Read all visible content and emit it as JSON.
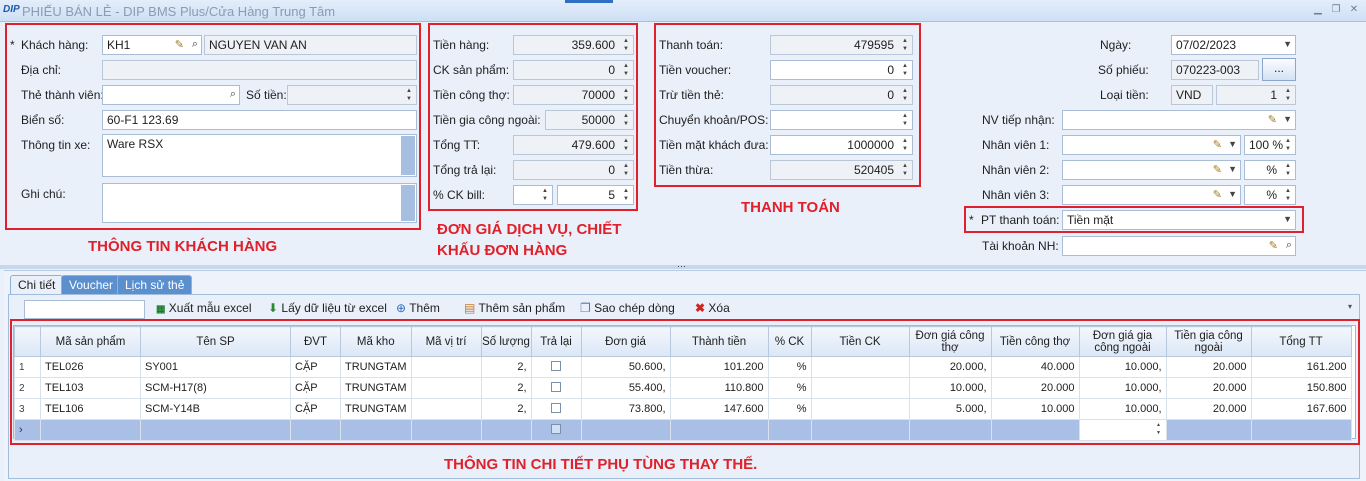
{
  "window": {
    "logo": "DIP",
    "title": "PHIẾU BÁN LẺ - DIP BMS Plus/Cửa Hàng Trung Tâm"
  },
  "customer": {
    "khach_hang_label": "Khách hàng:",
    "khach_hang_code": "KH1",
    "khach_hang_name": "NGUYEN VAN AN",
    "dia_chi_label": "Địa chỉ:",
    "the_thanh_vien_label": "Thẻ thành viên:",
    "so_tien_label": "Số tiền:",
    "bien_so_label": "Biển số:",
    "bien_so": "60-F1 123.69",
    "thong_tin_xe_label": "Thông tin xe:",
    "thong_tin_xe": "Ware RSX",
    "ghi_chu_label": "Ghi chú:",
    "section_label": "THÔNG TIN KHÁCH HÀNG"
  },
  "pricing": {
    "tien_hang_label": "Tiền hàng:",
    "tien_hang": "359.600",
    "ck_san_pham_label": "CK sản phẩm:",
    "ck_san_pham": "0",
    "tien_cong_tho_label": "Tiền công thợ:",
    "tien_cong_tho": "70000",
    "tien_gia_cong_ngoai_label": "Tiền gia công ngoài:",
    "tien_gia_cong_ngoai": "50000",
    "tong_tt_label": "Tổng TT:",
    "tong_tt": "479.600",
    "tong_tra_lai_label": "Tổng trả lại:",
    "tong_tra_lai": "0",
    "ck_bill_label": "% CK bill:",
    "ck_bill": "5",
    "section_label_1": "ĐƠN GIÁ DỊCH VỤ, CHIẾT",
    "section_label_2": "KHẤU ĐƠN HÀNG"
  },
  "payment": {
    "thanh_toan_label": "Thanh toán:",
    "thanh_toan": "479595",
    "tien_voucher_label": "Tiền voucher:",
    "tien_voucher": "0",
    "tru_tien_the_label": "Trừ tiền thẻ:",
    "tru_tien_the": "0",
    "chuyen_khoan_label": "Chuyển khoản/POS:",
    "tien_mat_label": "Tiền mặt khách đưa:",
    "tien_mat": "1000000",
    "tien_thua_label": "Tiền thừa:",
    "tien_thua": "520405",
    "section_label": "THANH TOÁN"
  },
  "info": {
    "ngay_label": "Ngày:",
    "ngay": "07/02/2023",
    "so_phieu_label": "Số phiếu:",
    "so_phieu": "070223-003",
    "browse": "...",
    "loai_tien_label": "Loại tiền:",
    "loai_tien": "VND",
    "ty_gia": "1",
    "nv_tiep_nhan_label": "NV tiếp nhận:",
    "nv1_label": "Nhân viên 1:",
    "nv1_pct": "100 %",
    "nv2_label": "Nhân viên 2:",
    "nv2_pct": "%",
    "nv3_label": "Nhân viên 3:",
    "nv3_pct": "%",
    "pt_thanh_toan_label": "PT thanh toán:",
    "pt_thanh_toan": "Tiền mặt",
    "tai_khoan_label": "Tài khoản NH:"
  },
  "tabs": [
    "Chi tiết",
    "Voucher",
    "Lịch sử thẻ"
  ],
  "toolbar": {
    "xuat_mau": "Xuất mẫu excel",
    "lay_du_lieu": "Lấy dữ liệu từ excel",
    "them": "Thêm",
    "them_san_pham": "Thêm sản phẩm",
    "sao_chep": "Sao chép dòng",
    "xoa": "Xóa"
  },
  "table": {
    "headers": [
      "Mã sản phẩm",
      "Tên SP",
      "ĐVT",
      "Mã kho",
      "Mã vị trí",
      "Số lượng",
      "Trả lại",
      "Đơn giá",
      "Thành tiền",
      "% CK",
      "Tiền CK",
      "Đơn giá công thợ",
      "Tiền công thợ",
      "Đơn giá gia công ngoài",
      "Tiền gia công ngoài",
      "Tổng TT"
    ],
    "rows": [
      {
        "idx": "1",
        "ma": "TEL026",
        "ten": "SY001",
        "dvt": "CẶP",
        "kho": "TRUNGTAM",
        "vitri": "",
        "sl": "2,",
        "don_gia": "50.600,",
        "thanh_tien": "101.200",
        "ck": "%",
        "tien_ck": "",
        "dg_cong": "20.000,",
        "tien_cong": "40.000",
        "dg_gc": "10.000,",
        "tien_gc": "20.000",
        "tong": "161.200"
      },
      {
        "idx": "2",
        "ma": "TEL103",
        "ten": "SCM-H17(8)",
        "dvt": "CẶP",
        "kho": "TRUNGTAM",
        "vitri": "",
        "sl": "2,",
        "don_gia": "55.400,",
        "thanh_tien": "110.800",
        "ck": "%",
        "tien_ck": "",
        "dg_cong": "10.000,",
        "tien_cong": "20.000",
        "dg_gc": "10.000,",
        "tien_gc": "20.000",
        "tong": "150.800"
      },
      {
        "idx": "3",
        "ma": "TEL106",
        "ten": "SCM-Y14B",
        "dvt": "CẶP",
        "kho": "TRUNGTAM",
        "vitri": "",
        "sl": "2,",
        "don_gia": "73.800,",
        "thanh_tien": "147.600",
        "ck": "%",
        "tien_ck": "",
        "dg_cong": "5.000,",
        "tien_cong": "10.000",
        "dg_gc": "10.000,",
        "tien_gc": "20.000",
        "tong": "167.600"
      }
    ]
  },
  "detail_label": "THÔNG TIN CHI TIẾT PHỤ TÙNG THAY THẾ."
}
